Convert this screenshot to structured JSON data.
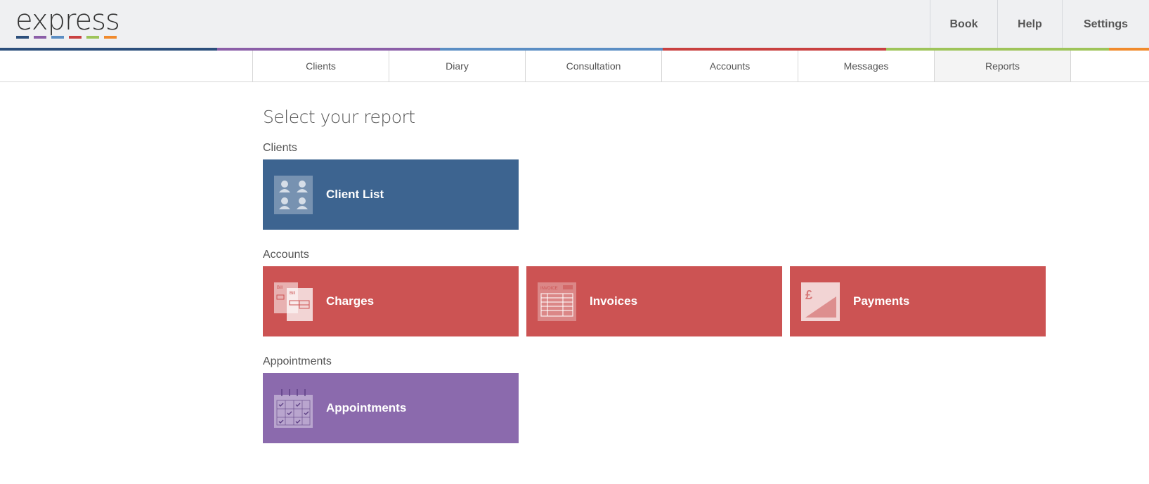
{
  "colors": {
    "blue": "#3d6490",
    "red": "#cc5353",
    "purple": "#8b6aad",
    "green": "#9ec45a",
    "orange": "#f08a2c",
    "lightblue": "#5b8ec4",
    "darkred": "#b84040"
  },
  "logo": {
    "text": "express"
  },
  "topnav": {
    "book": "Book",
    "help": "Help",
    "settings": "Settings"
  },
  "mainnav": {
    "tabs": [
      "Clients",
      "Diary",
      "Consultation",
      "Accounts",
      "Messages",
      "Reports"
    ],
    "active": "Reports"
  },
  "page": {
    "title": "Select your report"
  },
  "sections": {
    "clients": {
      "label": "Clients",
      "tiles": [
        {
          "label": "Client List",
          "icon": "client-list-icon"
        }
      ]
    },
    "accounts": {
      "label": "Accounts",
      "tiles": [
        {
          "label": "Charges",
          "icon": "charges-icon"
        },
        {
          "label": "Invoices",
          "icon": "invoices-icon"
        },
        {
          "label": "Payments",
          "icon": "payments-icon"
        }
      ]
    },
    "appointments": {
      "label": "Appointments",
      "tiles": [
        {
          "label": "Appointments",
          "icon": "calendar-icon"
        }
      ]
    }
  },
  "icon_text": {
    "bill": "Bill",
    "invoice": "INVOICE",
    "pound": "£"
  }
}
